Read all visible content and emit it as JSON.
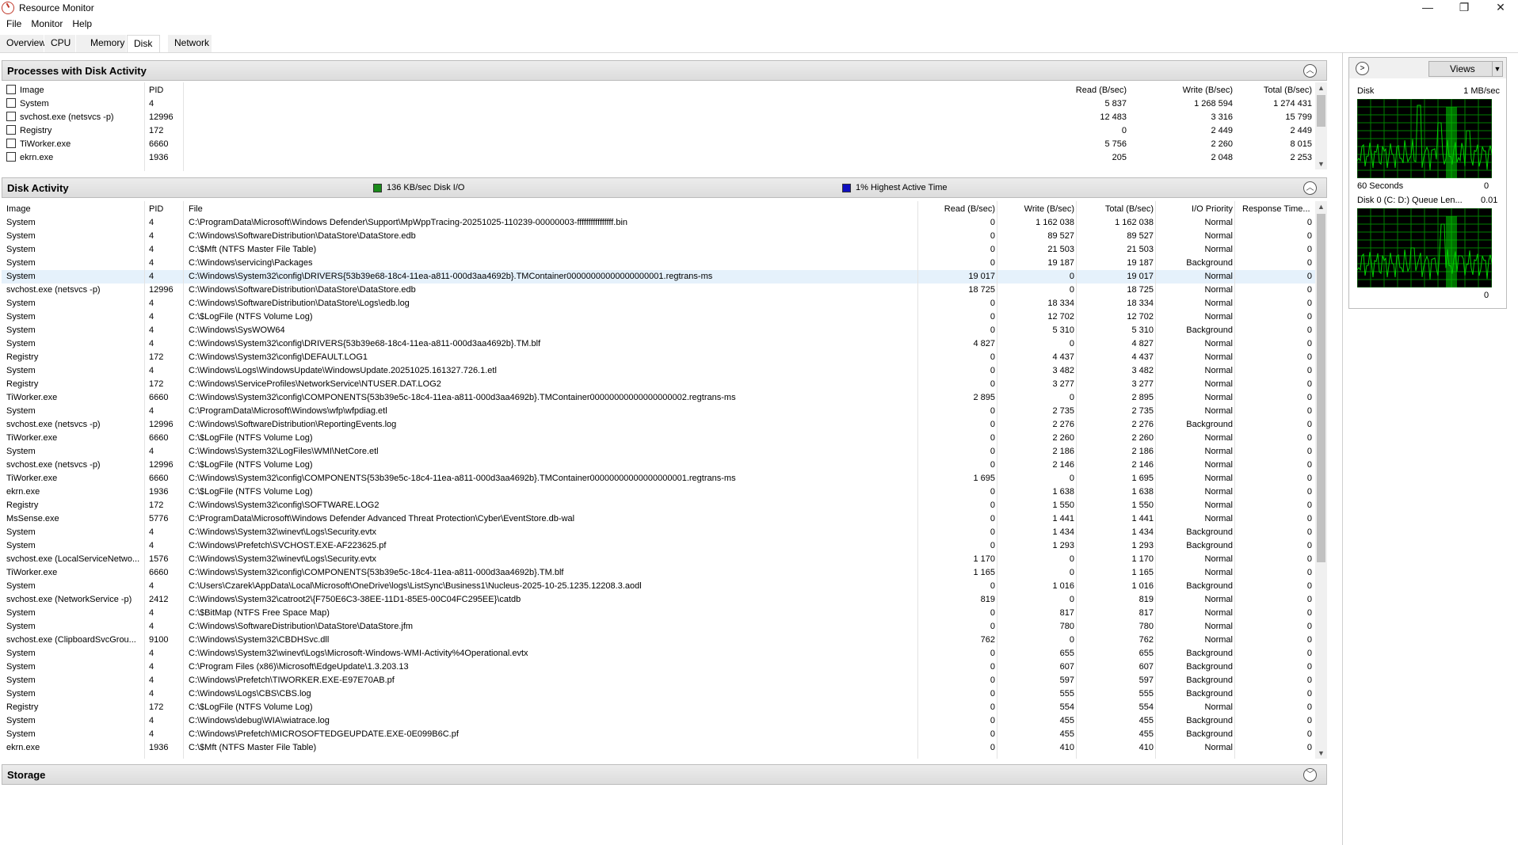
{
  "window": {
    "title": "Resource Monitor",
    "min": "—",
    "max": "❐",
    "close": "✕"
  },
  "menu": [
    "File",
    "Monitor",
    "Help"
  ],
  "tabs": [
    "Overview",
    "CPU",
    "Memory",
    "Disk",
    "Network"
  ],
  "active_tab": "Disk",
  "processes": {
    "title": "Processes with Disk Activity",
    "columns": [
      "Image",
      "PID",
      "Read (B/sec)",
      "Write (B/sec)",
      "Total (B/sec)"
    ],
    "rows": [
      [
        "System",
        "4",
        "5 837",
        "1 268 594",
        "1 274 431"
      ],
      [
        "svchost.exe (netsvcs -p)",
        "12996",
        "12 483",
        "3 316",
        "15 799"
      ],
      [
        "Registry",
        "172",
        "0",
        "2 449",
        "2 449"
      ],
      [
        "TiWorker.exe",
        "6660",
        "5 756",
        "2 260",
        "8 015"
      ],
      [
        "ekrn.exe",
        "1936",
        "205",
        "2 048",
        "2 253"
      ]
    ]
  },
  "disk_activity": {
    "title": "Disk Activity",
    "legend_io": "136 KB/sec Disk I/O",
    "legend_active": "1% Highest Active Time",
    "legend_io_color": "#1a8a1a",
    "legend_active_color": "#1010c0",
    "columns": [
      "Image",
      "PID",
      "File",
      "Read (B/sec)",
      "Write (B/sec)",
      "Total (B/sec)",
      "I/O Priority",
      "Response Time..."
    ],
    "rows": [
      [
        "System",
        "4",
        "C:\\ProgramData\\Microsoft\\Windows Defender\\Support\\MpWppTracing-20251025-110239-00000003-ffffffffffffffff.bin",
        "0",
        "1 162 038",
        "1 162 038",
        "Normal",
        "0"
      ],
      [
        "System",
        "4",
        "C:\\Windows\\SoftwareDistribution\\DataStore\\DataStore.edb",
        "0",
        "89 527",
        "89 527",
        "Normal",
        "0"
      ],
      [
        "System",
        "4",
        "C:\\$Mft (NTFS Master File Table)",
        "0",
        "21 503",
        "21 503",
        "Normal",
        "0"
      ],
      [
        "System",
        "4",
        "C:\\Windows\\servicing\\Packages",
        "0",
        "19 187",
        "19 187",
        "Background",
        "0"
      ],
      [
        "System",
        "4",
        "C:\\Windows\\System32\\config\\DRIVERS{53b39e68-18c4-11ea-a811-000d3aa4692b}.TMContainer00000000000000000001.regtrans-ms",
        "19 017",
        "0",
        "19 017",
        "Normal",
        "0"
      ],
      [
        "svchost.exe (netsvcs -p)",
        "12996",
        "C:\\Windows\\SoftwareDistribution\\DataStore\\DataStore.edb",
        "18 725",
        "0",
        "18 725",
        "Normal",
        "0"
      ],
      [
        "System",
        "4",
        "C:\\Windows\\SoftwareDistribution\\DataStore\\Logs\\edb.log",
        "0",
        "18 334",
        "18 334",
        "Normal",
        "0"
      ],
      [
        "System",
        "4",
        "C:\\$LogFile (NTFS Volume Log)",
        "0",
        "12 702",
        "12 702",
        "Normal",
        "0"
      ],
      [
        "System",
        "4",
        "C:\\Windows\\SysWOW64",
        "0",
        "5 310",
        "5 310",
        "Background",
        "0"
      ],
      [
        "System",
        "4",
        "C:\\Windows\\System32\\config\\DRIVERS{53b39e68-18c4-11ea-a811-000d3aa4692b}.TM.blf",
        "4 827",
        "0",
        "4 827",
        "Normal",
        "0"
      ],
      [
        "Registry",
        "172",
        "C:\\Windows\\System32\\config\\DEFAULT.LOG1",
        "0",
        "4 437",
        "4 437",
        "Normal",
        "0"
      ],
      [
        "System",
        "4",
        "C:\\Windows\\Logs\\WindowsUpdate\\WindowsUpdate.20251025.161327.726.1.etl",
        "0",
        "3 482",
        "3 482",
        "Normal",
        "0"
      ],
      [
        "Registry",
        "172",
        "C:\\Windows\\ServiceProfiles\\NetworkService\\NTUSER.DAT.LOG2",
        "0",
        "3 277",
        "3 277",
        "Normal",
        "0"
      ],
      [
        "TiWorker.exe",
        "6660",
        "C:\\Windows\\System32\\config\\COMPONENTS{53b39e5c-18c4-11ea-a811-000d3aa4692b}.TMContainer00000000000000000002.regtrans-ms",
        "2 895",
        "0",
        "2 895",
        "Normal",
        "0"
      ],
      [
        "System",
        "4",
        "C:\\ProgramData\\Microsoft\\Windows\\wfp\\wfpdiag.etl",
        "0",
        "2 735",
        "2 735",
        "Normal",
        "0"
      ],
      [
        "svchost.exe (netsvcs -p)",
        "12996",
        "C:\\Windows\\SoftwareDistribution\\ReportingEvents.log",
        "0",
        "2 276",
        "2 276",
        "Background",
        "0"
      ],
      [
        "TiWorker.exe",
        "6660",
        "C:\\$LogFile (NTFS Volume Log)",
        "0",
        "2 260",
        "2 260",
        "Normal",
        "0"
      ],
      [
        "System",
        "4",
        "C:\\Windows\\System32\\LogFiles\\WMI\\NetCore.etl",
        "0",
        "2 186",
        "2 186",
        "Normal",
        "0"
      ],
      [
        "svchost.exe (netsvcs -p)",
        "12996",
        "C:\\$LogFile (NTFS Volume Log)",
        "0",
        "2 146",
        "2 146",
        "Normal",
        "0"
      ],
      [
        "TiWorker.exe",
        "6660",
        "C:\\Windows\\System32\\config\\COMPONENTS{53b39e5c-18c4-11ea-a811-000d3aa4692b}.TMContainer00000000000000000001.regtrans-ms",
        "1 695",
        "0",
        "1 695",
        "Normal",
        "0"
      ],
      [
        "ekrn.exe",
        "1936",
        "C:\\$LogFile (NTFS Volume Log)",
        "0",
        "1 638",
        "1 638",
        "Normal",
        "0"
      ],
      [
        "Registry",
        "172",
        "C:\\Windows\\System32\\config\\SOFTWARE.LOG2",
        "0",
        "1 550",
        "1 550",
        "Normal",
        "0"
      ],
      [
        "MsSense.exe",
        "5776",
        "C:\\ProgramData\\Microsoft\\Windows Defender Advanced Threat Protection\\Cyber\\EventStore.db-wal",
        "0",
        "1 441",
        "1 441",
        "Normal",
        "0"
      ],
      [
        "System",
        "4",
        "C:\\Windows\\System32\\winevt\\Logs\\Security.evtx",
        "0",
        "1 434",
        "1 434",
        "Background",
        "0"
      ],
      [
        "System",
        "4",
        "C:\\Windows\\Prefetch\\SVCHOST.EXE-AF223625.pf",
        "0",
        "1 293",
        "1 293",
        "Background",
        "0"
      ],
      [
        "svchost.exe (LocalServiceNetwo...",
        "1576",
        "C:\\Windows\\System32\\winevt\\Logs\\Security.evtx",
        "1 170",
        "0",
        "1 170",
        "Normal",
        "0"
      ],
      [
        "TiWorker.exe",
        "6660",
        "C:\\Windows\\System32\\config\\COMPONENTS{53b39e5c-18c4-11ea-a811-000d3aa4692b}.TM.blf",
        "1 165",
        "0",
        "1 165",
        "Normal",
        "0"
      ],
      [
        "System",
        "4",
        "C:\\Users\\Czarek\\AppData\\Local\\Microsoft\\OneDrive\\logs\\ListSync\\Business1\\Nucleus-2025-10-25.1235.12208.3.aodl",
        "0",
        "1 016",
        "1 016",
        "Background",
        "0"
      ],
      [
        "svchost.exe (NetworkService -p)",
        "2412",
        "C:\\Windows\\System32\\catroot2\\{F750E6C3-38EE-11D1-85E5-00C04FC295EE}\\catdb",
        "819",
        "0",
        "819",
        "Normal",
        "0"
      ],
      [
        "System",
        "4",
        "C:\\$BitMap (NTFS Free Space Map)",
        "0",
        "817",
        "817",
        "Normal",
        "0"
      ],
      [
        "System",
        "4",
        "C:\\Windows\\SoftwareDistribution\\DataStore\\DataStore.jfm",
        "0",
        "780",
        "780",
        "Normal",
        "0"
      ],
      [
        "svchost.exe (ClipboardSvcGrou...",
        "9100",
        "C:\\Windows\\System32\\CBDHSvc.dll",
        "762",
        "0",
        "762",
        "Normal",
        "0"
      ],
      [
        "System",
        "4",
        "C:\\Windows\\System32\\winevt\\Logs\\Microsoft-Windows-WMI-Activity%4Operational.evtx",
        "0",
        "655",
        "655",
        "Background",
        "0"
      ],
      [
        "System",
        "4",
        "C:\\Program Files (x86)\\Microsoft\\EdgeUpdate\\1.3.203.13",
        "0",
        "607",
        "607",
        "Background",
        "0"
      ],
      [
        "System",
        "4",
        "C:\\Windows\\Prefetch\\TIWORKER.EXE-E97E70AB.pf",
        "0",
        "597",
        "597",
        "Background",
        "0"
      ],
      [
        "System",
        "4",
        "C:\\Windows\\Logs\\CBS\\CBS.log",
        "0",
        "555",
        "555",
        "Background",
        "0"
      ],
      [
        "Registry",
        "172",
        "C:\\$LogFile (NTFS Volume Log)",
        "0",
        "554",
        "554",
        "Normal",
        "0"
      ],
      [
        "System",
        "4",
        "C:\\Windows\\debug\\WIA\\wiatrace.log",
        "0",
        "455",
        "455",
        "Background",
        "0"
      ],
      [
        "System",
        "4",
        "C:\\Windows\\Prefetch\\MICROSOFTEDGEUPDATE.EXE-0E099B6C.pf",
        "0",
        "455",
        "455",
        "Background",
        "0"
      ],
      [
        "ekrn.exe",
        "1936",
        "C:\\$Mft (NTFS Master File Table)",
        "0",
        "410",
        "410",
        "Normal",
        "0"
      ]
    ]
  },
  "storage": {
    "title": "Storage"
  },
  "right_pane": {
    "views_label": "Views",
    "graph1": {
      "label": "Disk",
      "scale": "1 MB/sec",
      "time": "60 Seconds",
      "min": "0"
    },
    "graph2": {
      "label": "Disk 0 (C: D:) Queue Len...",
      "scale": "0.01",
      "min": "0"
    },
    "graph_line_color": "#00d000",
    "graph_grid_color": "#008000"
  }
}
